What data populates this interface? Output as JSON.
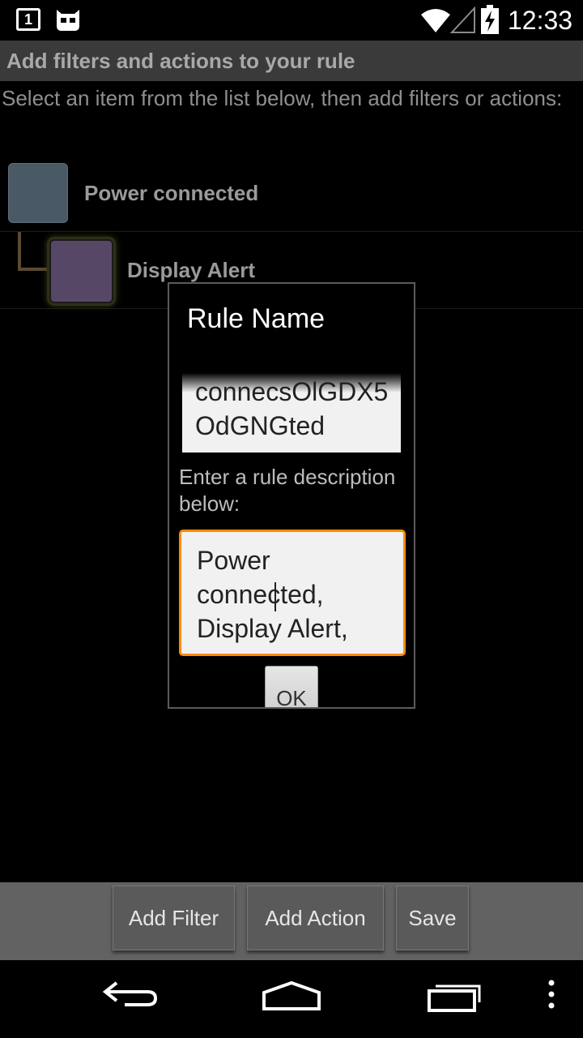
{
  "status_bar": {
    "time": "12:33",
    "notification_count": "1",
    "icons": [
      "notification-1-icon",
      "cyanogen-mascot-icon",
      "wifi-icon",
      "cell-signal-icon",
      "battery-charging-icon"
    ]
  },
  "header": {
    "title": "Add filters and actions to your rule"
  },
  "instructions": "Select an item from the list below, then add filters or actions:",
  "rule_tree": {
    "items": [
      {
        "label": "Power connected",
        "kind": "filter",
        "color": "#4a5966"
      },
      {
        "label": "Display Alert",
        "kind": "action",
        "color": "#574766"
      }
    ]
  },
  "dialog": {
    "title": "Rule Name",
    "rule_name_value": "connecsOlGDX5OdGNGted",
    "description_label": "Enter a rule description below:",
    "description_value": "Power\nconnected,\nDisplay Alert,",
    "ok_label": "OK",
    "focus_color": "#ff8a00"
  },
  "action_bar": {
    "add_filter_label": "Add Filter",
    "add_action_label": "Add Action",
    "save_label": "Save"
  },
  "nav_bar": {
    "icons": [
      "back-icon",
      "home-icon",
      "recent-apps-icon",
      "menu-overflow-icon"
    ]
  }
}
